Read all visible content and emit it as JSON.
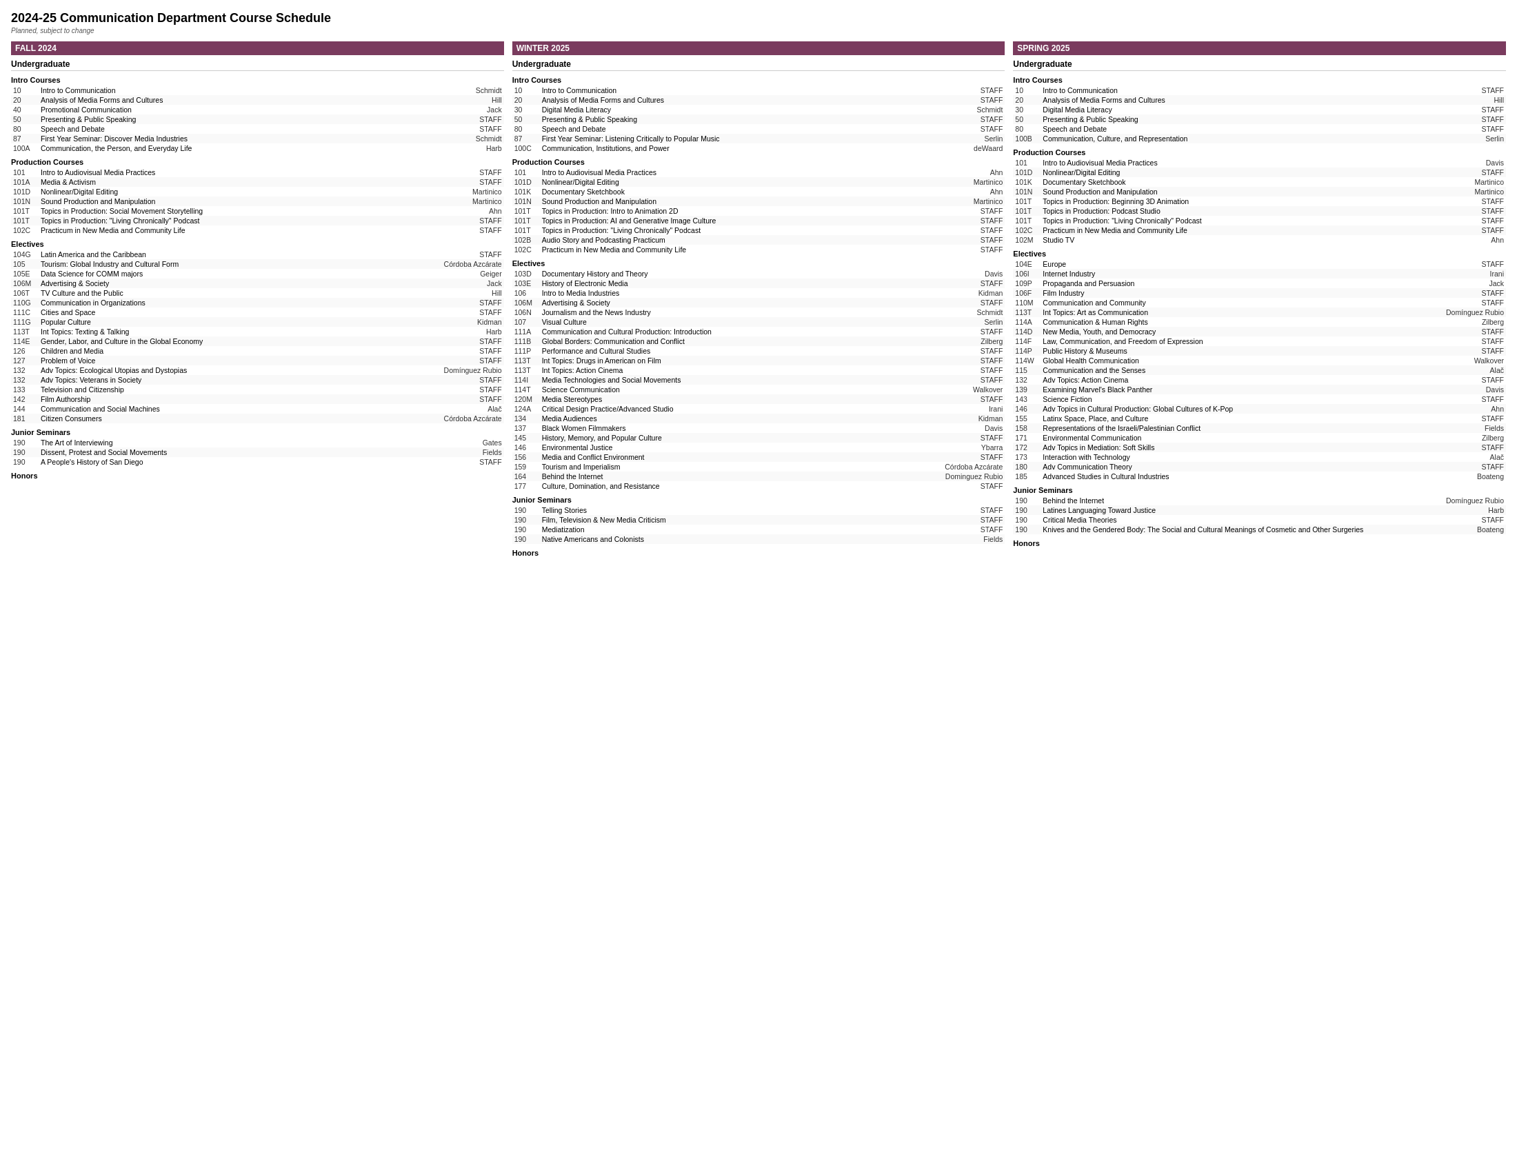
{
  "title": "2024-25 Communication Department Course Schedule",
  "subtitle": "Planned, subject to change",
  "fall": {
    "label": "FALL 2024",
    "undergrad": "Undergraduate",
    "sections": [
      {
        "name": "Intro Courses",
        "courses": [
          {
            "num": "10",
            "title": "Intro to Communication",
            "instructor": "Schmidt"
          },
          {
            "num": "20",
            "title": "Analysis of Media Forms and Cultures",
            "instructor": "Hill"
          },
          {
            "num": "40",
            "title": "Promotional Communication",
            "instructor": "Jack"
          },
          {
            "num": "50",
            "title": "Presenting & Public Speaking",
            "instructor": "STAFF"
          },
          {
            "num": "80",
            "title": "Speech and Debate",
            "instructor": "STAFF"
          },
          {
            "num": "87",
            "title": "First Year Seminar: Discover Media Industries",
            "instructor": "Schmidt"
          },
          {
            "num": "100A",
            "title": "Communication, the Person, and Everyday Life",
            "instructor": "Harb"
          }
        ]
      },
      {
        "name": "Production Courses",
        "courses": [
          {
            "num": "101",
            "title": "Intro to Audiovisual Media Practices",
            "instructor": "STAFF"
          },
          {
            "num": "101A",
            "title": "Media & Activism",
            "instructor": "STAFF"
          },
          {
            "num": "101D",
            "title": "Nonlinear/Digital Editing",
            "instructor": "Martinico"
          },
          {
            "num": "101N",
            "title": "Sound Production and Manipulation",
            "instructor": "Martinico"
          },
          {
            "num": "101T",
            "title": "Topics in Production: Social Movement Storytelling",
            "instructor": "Ahn"
          },
          {
            "num": "101T",
            "title": "Topics in Production: \"Living Chronically\" Podcast",
            "instructor": "STAFF"
          },
          {
            "num": "102C",
            "title": "Practicum in New Media and Community Life",
            "instructor": "STAFF"
          }
        ]
      },
      {
        "name": "Electives",
        "courses": [
          {
            "num": "104G",
            "title": "Latin America and the Caribbean",
            "instructor": "STAFF"
          },
          {
            "num": "105",
            "title": "Tourism: Global Industry and Cultural Form",
            "instructor": "Córdoba Azcárate"
          },
          {
            "num": "105E",
            "title": "Data Science for COMM majors",
            "instructor": "Geiger"
          },
          {
            "num": "106M",
            "title": "Advertising & Society",
            "instructor": "Jack"
          },
          {
            "num": "106T",
            "title": "TV Culture and the Public",
            "instructor": "Hill"
          },
          {
            "num": "110G",
            "title": "Communication in Organizations",
            "instructor": "STAFF"
          },
          {
            "num": "111C",
            "title": "Cities and Space",
            "instructor": "STAFF"
          },
          {
            "num": "111G",
            "title": "Popular Culture",
            "instructor": "Kidman"
          },
          {
            "num": "113T",
            "title": "Int Topics: Texting & Talking",
            "instructor": "Harb"
          },
          {
            "num": "114E",
            "title": "Gender, Labor, and Culture in the Global Economy",
            "instructor": "STAFF"
          },
          {
            "num": "126",
            "title": "Children and Media",
            "instructor": "STAFF"
          },
          {
            "num": "127",
            "title": "Problem of Voice",
            "instructor": "STAFF"
          },
          {
            "num": "132",
            "title": "Adv Topics: Ecological Utopias and Dystopias",
            "instructor": "Domínguez Rubio"
          },
          {
            "num": "132",
            "title": "Adv Topics: Veterans in Society",
            "instructor": "STAFF"
          },
          {
            "num": "133",
            "title": "Television and Citizenship",
            "instructor": "STAFF"
          },
          {
            "num": "142",
            "title": "Film Authorship",
            "instructor": "STAFF"
          },
          {
            "num": "144",
            "title": "Communication and Social Machines",
            "instructor": "Alač"
          },
          {
            "num": "181",
            "title": "Citizen Consumers",
            "instructor": "Córdoba Azcárate"
          }
        ]
      },
      {
        "name": "Junior Seminars",
        "courses": [
          {
            "num": "190",
            "title": "The Art of Interviewing",
            "instructor": "Gates"
          },
          {
            "num": "190",
            "title": "Dissent, Protest and Social Movements",
            "instructor": "Fields"
          },
          {
            "num": "190",
            "title": "A People's History of San Diego",
            "instructor": "STAFF"
          }
        ]
      },
      {
        "name": "Honors",
        "courses": []
      }
    ]
  },
  "winter": {
    "label": "WINTER 2025",
    "undergrad": "Undergraduate",
    "sections": [
      {
        "name": "Intro Courses",
        "courses": [
          {
            "num": "10",
            "title": "Intro to Communication",
            "instructor": "STAFF"
          },
          {
            "num": "20",
            "title": "Analysis of Media Forms and Cultures",
            "instructor": "STAFF"
          },
          {
            "num": "30",
            "title": "Digital Media Literacy",
            "instructor": "Schmidt"
          },
          {
            "num": "50",
            "title": "Presenting & Public Speaking",
            "instructor": "STAFF"
          },
          {
            "num": "80",
            "title": "Speech and Debate",
            "instructor": "STAFF"
          },
          {
            "num": "87",
            "title": "First Year Seminar: Listening Critically to Popular Music",
            "instructor": "Serlin"
          },
          {
            "num": "100C",
            "title": "Communication, Institutions, and Power",
            "instructor": "deWaard"
          }
        ]
      },
      {
        "name": "Production Courses",
        "courses": [
          {
            "num": "101",
            "title": "Intro to Audiovisual Media Practices",
            "instructor": "Ahn"
          },
          {
            "num": "101D",
            "title": "Nonlinear/Digital Editing",
            "instructor": "Martinico"
          },
          {
            "num": "101K",
            "title": "Documentary Sketchbook",
            "instructor": "Ahn"
          },
          {
            "num": "101N",
            "title": "Sound Production and Manipulation",
            "instructor": "Martinico"
          },
          {
            "num": "101T",
            "title": "Topics in Production: Intro to Animation 2D",
            "instructor": "STAFF"
          },
          {
            "num": "101T",
            "title": "Topics in Production: AI and Generative Image Culture",
            "instructor": "STAFF"
          },
          {
            "num": "101T",
            "title": "Topics in Production: \"Living Chronically\" Podcast",
            "instructor": "STAFF"
          },
          {
            "num": "102B",
            "title": "Audio Story and Podcasting Practicum",
            "instructor": "STAFF"
          },
          {
            "num": "102C",
            "title": "Practicum in New Media and Community Life",
            "instructor": "STAFF"
          }
        ]
      },
      {
        "name": "Electives",
        "courses": [
          {
            "num": "103D",
            "title": "Documentary History and Theory",
            "instructor": "Davis"
          },
          {
            "num": "103E",
            "title": "History of Electronic Media",
            "instructor": "STAFF"
          },
          {
            "num": "106",
            "title": "Intro to Media Industries",
            "instructor": "Kidman"
          },
          {
            "num": "106M",
            "title": "Advertising & Society",
            "instructor": "STAFF"
          },
          {
            "num": "106N",
            "title": "Journalism and the News Industry",
            "instructor": "Schmidt"
          },
          {
            "num": "107",
            "title": "Visual Culture",
            "instructor": "Serlin"
          },
          {
            "num": "111A",
            "title": "Communication and Cultural Production: Introduction",
            "instructor": "STAFF"
          },
          {
            "num": "111B",
            "title": "Global Borders: Communication and Conflict",
            "instructor": "Zilberg"
          },
          {
            "num": "111P",
            "title": "Performance and Cultural Studies",
            "instructor": "STAFF"
          },
          {
            "num": "113T",
            "title": "Int Topics: Drugs in American on Film",
            "instructor": "STAFF"
          },
          {
            "num": "113T",
            "title": "Int Topics: Action Cinema",
            "instructor": "STAFF"
          },
          {
            "num": "114I",
            "title": "Media Technologies and Social Movements",
            "instructor": "STAFF"
          },
          {
            "num": "114T",
            "title": "Science Communication",
            "instructor": "Walkover"
          },
          {
            "num": "120M",
            "title": "Media Stereotypes",
            "instructor": "STAFF"
          },
          {
            "num": "124A",
            "title": "Critical Design Practice/Advanced Studio",
            "instructor": "Irani"
          },
          {
            "num": "134",
            "title": "Media Audiences",
            "instructor": "Kidman"
          },
          {
            "num": "137",
            "title": "Black Women Filmmakers",
            "instructor": "Davis"
          },
          {
            "num": "145",
            "title": "History, Memory, and Popular Culture",
            "instructor": "STAFF"
          },
          {
            "num": "146",
            "title": "Environmental Justice",
            "instructor": "Ybarra"
          },
          {
            "num": "156",
            "title": "Media and Conflict Environment",
            "instructor": "STAFF"
          },
          {
            "num": "159",
            "title": "Tourism and Imperialism",
            "instructor": "Córdoba Azcárate"
          },
          {
            "num": "164",
            "title": "Behind the Internet",
            "instructor": "Dominguez Rubio"
          },
          {
            "num": "177",
            "title": "Culture, Domination, and Resistance",
            "instructor": "STAFF"
          }
        ]
      },
      {
        "name": "Junior Seminars",
        "courses": [
          {
            "num": "190",
            "title": "Telling Stories",
            "instructor": "STAFF"
          },
          {
            "num": "190",
            "title": "Film, Television & New Media Criticism",
            "instructor": "STAFF"
          },
          {
            "num": "190",
            "title": "Mediatization",
            "instructor": "STAFF"
          },
          {
            "num": "190",
            "title": "Native Americans and Colonists",
            "instructor": "Fields"
          }
        ]
      },
      {
        "name": "Honors",
        "courses": []
      }
    ]
  },
  "spring": {
    "label": "SPRING 2025",
    "undergrad": "Undergraduate",
    "sections": [
      {
        "name": "Intro Courses",
        "courses": [
          {
            "num": "10",
            "title": "Intro to Communication",
            "instructor": "STAFF"
          },
          {
            "num": "20",
            "title": "Analysis of Media Forms and Cultures",
            "instructor": "Hill"
          },
          {
            "num": "30",
            "title": "Digital Media Literacy",
            "instructor": "STAFF"
          },
          {
            "num": "50",
            "title": "Presenting & Public Speaking",
            "instructor": "STAFF"
          },
          {
            "num": "80",
            "title": "Speech and Debate",
            "instructor": "STAFF"
          },
          {
            "num": "100B",
            "title": "Communication, Culture, and Representation",
            "instructor": "Serlin"
          }
        ]
      },
      {
        "name": "Production Courses",
        "courses": [
          {
            "num": "101",
            "title": "Intro to Audiovisual Media Practices",
            "instructor": "Davis"
          },
          {
            "num": "101D",
            "title": "Nonlinear/Digital Editing",
            "instructor": "STAFF"
          },
          {
            "num": "101K",
            "title": "Documentary Sketchbook",
            "instructor": "Martinico"
          },
          {
            "num": "101N",
            "title": "Sound Production and Manipulation",
            "instructor": "Martinico"
          },
          {
            "num": "101T",
            "title": "Topics in Production: Beginning 3D Animation",
            "instructor": "STAFF"
          },
          {
            "num": "101T",
            "title": "Topics in Production: Podcast Studio",
            "instructor": "STAFF"
          },
          {
            "num": "101T",
            "title": "Topics in Production: \"Living Chronically\" Podcast",
            "instructor": "STAFF"
          },
          {
            "num": "102C",
            "title": "Practicum in New Media and Community Life",
            "instructor": "STAFF"
          },
          {
            "num": "102M",
            "title": "Studio TV",
            "instructor": "Ahn"
          }
        ]
      },
      {
        "name": "Electives",
        "courses": [
          {
            "num": "104E",
            "title": "Europe",
            "instructor": "STAFF"
          },
          {
            "num": "106I",
            "title": "Internet Industry",
            "instructor": "Irani"
          },
          {
            "num": "109P",
            "title": "Propaganda and Persuasion",
            "instructor": "Jack"
          },
          {
            "num": "106F",
            "title": "Film Industry",
            "instructor": "STAFF"
          },
          {
            "num": "110M",
            "title": "Communication and Community",
            "instructor": "STAFF"
          },
          {
            "num": "113T",
            "title": "Int Topics: Art as Communication",
            "instructor": "Domínguez Rubio"
          },
          {
            "num": "114A",
            "title": "Communication & Human Rights",
            "instructor": "Zilberg"
          },
          {
            "num": "114D",
            "title": "New Media, Youth, and Democracy",
            "instructor": "STAFF"
          },
          {
            "num": "114F",
            "title": "Law, Communication, and Freedom of Expression",
            "instructor": "STAFF"
          },
          {
            "num": "114P",
            "title": "Public History & Museums",
            "instructor": "STAFF"
          },
          {
            "num": "114W",
            "title": "Global Health Communication",
            "instructor": "Walkover"
          },
          {
            "num": "115",
            "title": "Communication and the Senses",
            "instructor": "Alač"
          },
          {
            "num": "132",
            "title": "Adv Topics: Action Cinema",
            "instructor": "STAFF"
          },
          {
            "num": "139",
            "title": "Examining Marvel's Black Panther",
            "instructor": "Davis"
          },
          {
            "num": "143",
            "title": "Science Fiction",
            "instructor": "STAFF"
          },
          {
            "num": "146",
            "title": "Adv Topics in Cultural Production: Global Cultures of K-Pop",
            "instructor": "Ahn"
          },
          {
            "num": "155",
            "title": "Latinx Space, Place, and Culture",
            "instructor": "STAFF"
          },
          {
            "num": "158",
            "title": "Representations of the Israeli/Palestinian Conflict",
            "instructor": "Fields"
          },
          {
            "num": "171",
            "title": "Environmental Communication",
            "instructor": "Zilberg"
          },
          {
            "num": "172",
            "title": "Adv Topics in Mediation: Soft Skills",
            "instructor": "STAFF"
          },
          {
            "num": "173",
            "title": "Interaction with Technology",
            "instructor": "Alač"
          },
          {
            "num": "180",
            "title": "Adv Communication Theory",
            "instructor": "STAFF"
          },
          {
            "num": "185",
            "title": "Advanced Studies in Cultural Industries",
            "instructor": "Boateng"
          }
        ]
      },
      {
        "name": "Junior Seminars",
        "courses": [
          {
            "num": "190",
            "title": "Behind the Internet",
            "instructor": "Domínguez Rubio"
          },
          {
            "num": "190",
            "title": "Latines Languaging Toward Justice",
            "instructor": "Harb"
          },
          {
            "num": "190",
            "title": "Critical Media Theories",
            "instructor": "STAFF"
          },
          {
            "num": "190",
            "title": "Knives and the Gendered Body: The Social and Cultural Meanings of Cosmetic and Other Surgeries",
            "instructor": "Boateng"
          }
        ]
      },
      {
        "name": "Honors",
        "courses": []
      }
    ]
  }
}
